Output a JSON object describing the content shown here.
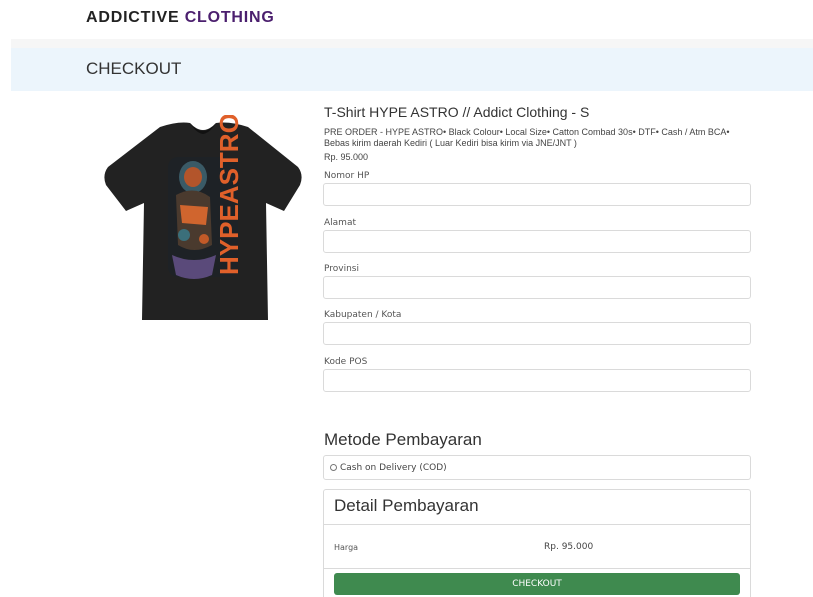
{
  "header": {
    "brand_main": "ADDICTIVE",
    "brand_accent": "CLOTHING",
    "brand_accent_color": "#4b1f6e"
  },
  "checkout_bar": {
    "title": "CHECKOUT"
  },
  "product": {
    "image_icon": "tshirt-black-hype-astro",
    "title": "T-Shirt HYPE ASTRO // Addict Clothing - S",
    "description": "PRE ORDER - HYPE ASTRO• Black Colour• Local Size• Catton Combad 30s• DTF• Cash / Atm BCA• Bebas kirim daerah Kediri ( Luar Kediri bisa kirim via JNE/JNT )",
    "price": "Rp. 95.000"
  },
  "form": {
    "fields": [
      {
        "label": "Nomor HP",
        "value": ""
      },
      {
        "label": "Alamat",
        "value": ""
      },
      {
        "label": "Provinsi",
        "value": ""
      },
      {
        "label": "Kabupaten / Kota",
        "value": ""
      },
      {
        "label": "Kode POS",
        "value": ""
      }
    ]
  },
  "payment": {
    "title": "Metode Pembayaran",
    "option_label": "Cash on Delivery (COD)"
  },
  "detail": {
    "title": "Detail Pembayaran",
    "row_label": "Harga",
    "row_value": "Rp. 95.000"
  },
  "actions": {
    "checkout_label": "CHECKOUT",
    "checkout_color": "#3f8a4f"
  }
}
